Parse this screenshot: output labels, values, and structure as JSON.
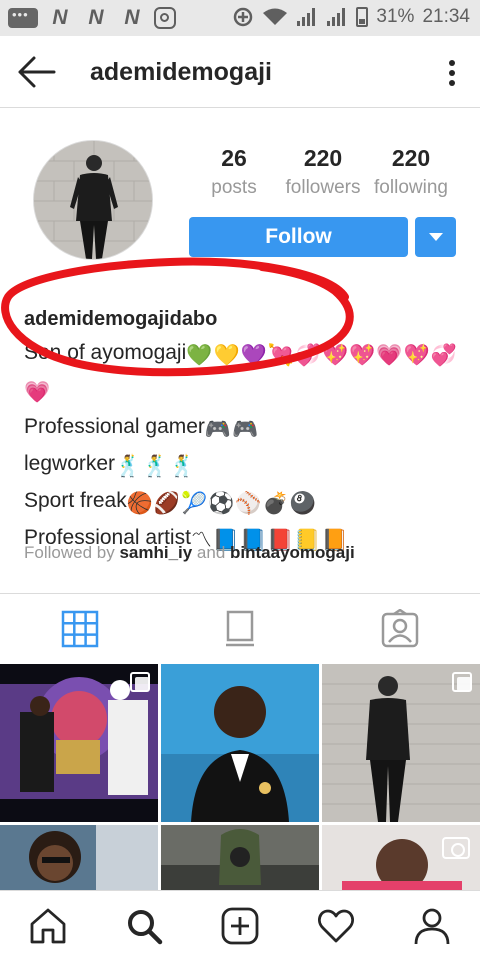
{
  "status_bar": {
    "network_labels": [
      "N",
      "N",
      "N"
    ],
    "battery": "31%",
    "time": "21:34"
  },
  "header": {
    "username": "ademidemogaji"
  },
  "profile": {
    "stats": [
      {
        "value": "26",
        "label": "posts"
      },
      {
        "value": "220",
        "label": "followers"
      },
      {
        "value": "220",
        "label": "following"
      }
    ],
    "follow_label": "Follow",
    "full_name": "ademidemogajidabo",
    "bio_lines": [
      {
        "text": "Son of ayomogaji",
        "emojis": [
          "💚",
          "💛",
          "💜",
          "💘",
          "💞",
          "💖",
          "💖",
          "💗",
          "💖",
          "💞",
          "💗"
        ]
      },
      {
        "text": "Professional gamer",
        "emojis": [
          "🎮",
          "🎮"
        ]
      },
      {
        "text": "legworker",
        "emojis": [
          "🕺",
          "🕺",
          "🕺"
        ]
      },
      {
        "text": "Sport freak",
        "emojis": [
          "🏀",
          "🏈",
          "🎾",
          "⚽",
          "⚾",
          "💣",
          "🎱"
        ]
      },
      {
        "text": "Professional artist",
        "emojis": [
          "〽",
          "📘",
          "📘",
          "📕",
          "📒",
          "📙"
        ]
      }
    ],
    "followed_by_prefix": "Followed by ",
    "followed_by_user_1": "samhi_iy",
    "followed_by_and": " and ",
    "followed_by_user_2": "bintaayomogaji"
  },
  "colors": {
    "accent": "#3897f0",
    "annotation": "#e8161b"
  },
  "tabs": [
    "grid-icon",
    "feed-icon",
    "tagged-icon"
  ],
  "bottom_nav": [
    "home-icon",
    "search-icon",
    "add-icon",
    "heart-icon",
    "profile-icon"
  ]
}
